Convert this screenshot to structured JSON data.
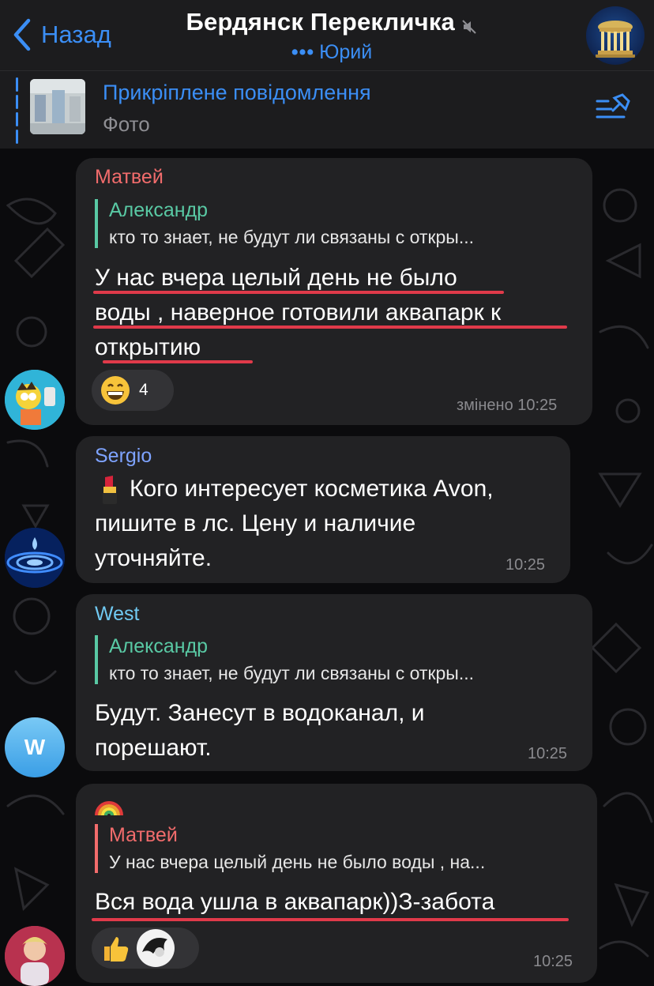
{
  "header": {
    "back_label": "Назад",
    "title": "Бердянск Перекличка",
    "typing_dots": "•••",
    "typing_user": "Юрий"
  },
  "pinned": {
    "title": "Прикріплене повідомлення",
    "subtitle": "Фото"
  },
  "messages": [
    {
      "sender": "Матвей",
      "sender_color": "#f26c6c",
      "reply_name": "Александр",
      "reply_text": "кто то знает, не будут ли связаны с откры...",
      "lines": [
        "У нас вчера целый день не было",
        "воды , наверное готовили аквапарк к",
        "открытию"
      ],
      "reaction_emoji": "grinning-face",
      "reaction_count": "4",
      "time": "змінено 10:25"
    },
    {
      "sender": "Sergio",
      "sender_color": "#7ea3ff",
      "emoji": "lipstick",
      "lines": [
        "Кого интересует косметика Avon,",
        "пишите в лс. Цену и наличие",
        "уточняйте."
      ],
      "time": "10:25"
    },
    {
      "sender": "West",
      "sender_color": "#70c9f2",
      "avatar_letter": "W",
      "reply_name": "Александр",
      "reply_text": "кто то знает, не будут ли связаны с откры...",
      "lines": [
        "Будут. Занесут в водоканал, и",
        "порешают."
      ],
      "time": "10:25"
    },
    {
      "sender_emoji": "rainbow",
      "reply_name": "Матвей",
      "reply_text": "У нас вчера целый день не было воды , на...",
      "lines": [
        "Вся вода ушла в аквапарк))З-забота"
      ],
      "reaction_emoji": "thumbs-up",
      "time": "10:25"
    }
  ],
  "colors": {
    "accent": "#3b8ef5",
    "bubble": "#222224",
    "reply_green": "#59c9a4",
    "reply_red": "#f26c6c",
    "underline": "#e03a4a"
  }
}
